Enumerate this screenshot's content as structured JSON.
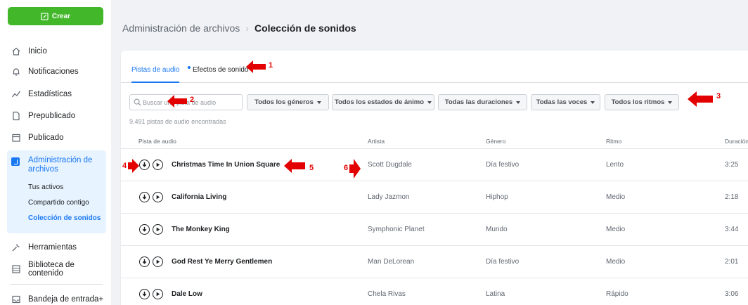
{
  "sidebar": {
    "create_label": "Crear",
    "items": [
      {
        "label": "Inicio",
        "icon": "home-icon"
      },
      {
        "label": "Notificaciones",
        "icon": "bell-icon"
      },
      {
        "label": "Estadísticas",
        "icon": "stats-icon"
      },
      {
        "label": "Prepublicado",
        "icon": "document-icon"
      },
      {
        "label": "Publicado",
        "icon": "calendar-icon"
      },
      {
        "label": "Administración de archivos",
        "icon": "media-icon"
      },
      {
        "label": "Herramientas",
        "icon": "wrench-icon"
      },
      {
        "label": "Biblioteca de contenido",
        "icon": "library-icon"
      },
      {
        "label": "Bandeja de entrada+",
        "icon": "inbox-icon"
      }
    ],
    "subitems": [
      "Tus activos",
      "Compartido contigo",
      "Colección de sonidos"
    ]
  },
  "breadcrumb": {
    "parent": "Administración de archivos",
    "current": "Colección de sonidos"
  },
  "tabs": [
    {
      "label": "Pistas de audio",
      "active": true
    },
    {
      "label": "Efectos de sonido",
      "active": false
    }
  ],
  "search": {
    "placeholder": "Buscar una pista de audio"
  },
  "filters": [
    "Todos los géneros",
    "Todos los estados de ánimo",
    "Todas las duraciones",
    "Todas las voces",
    "Todos los ritmos"
  ],
  "result_count": "9.491 pistas de audio encontradas",
  "columns": [
    "Pista de audio",
    "Artista",
    "Género",
    "Ritmo",
    "Duración"
  ],
  "tracks": [
    {
      "title": "Christmas Time In Union Square",
      "artist": "Scott Dugdale",
      "genre": "Día festivo",
      "tempo": "Lento",
      "duration": "3:25"
    },
    {
      "title": "California Living",
      "artist": "Lady Jazmon",
      "genre": "Hiphop",
      "tempo": "Medio",
      "duration": "2:18"
    },
    {
      "title": "The Monkey King",
      "artist": "Symphonic Planet",
      "genre": "Mundo",
      "tempo": "Medio",
      "duration": "3:44"
    },
    {
      "title": "God Rest Ye Merry Gentlemen",
      "artist": "Man DeLorean",
      "genre": "Día festivo",
      "tempo": "Medio",
      "duration": "2:01"
    },
    {
      "title": "Dale Low",
      "artist": "Chela Rivas",
      "genre": "Latina",
      "tempo": "Rápido",
      "duration": "3:06"
    }
  ],
  "annotations": [
    "1",
    "2",
    "3",
    "4",
    "5",
    "6"
  ],
  "colors": {
    "accent": "#1877f2",
    "create": "#42b72a",
    "annotation": "#e30000"
  }
}
